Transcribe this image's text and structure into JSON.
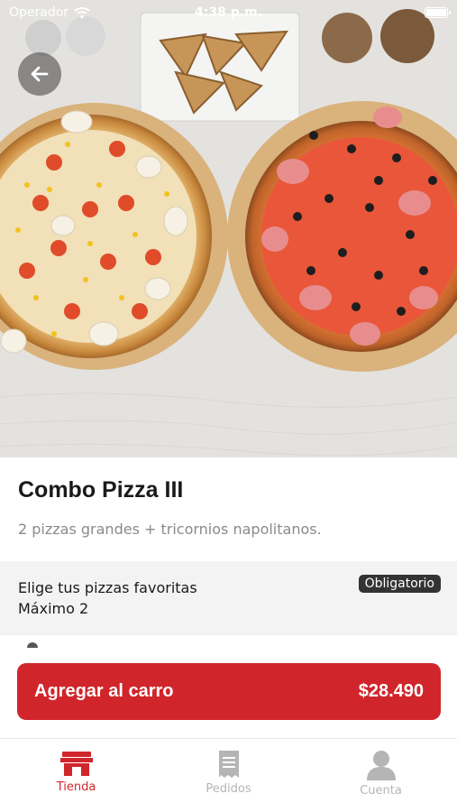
{
  "status_bar": {
    "carrier": "Operador",
    "time": "4:38 p.m."
  },
  "product": {
    "name": "Combo Pizza III",
    "description": "2 pizzas grandes + tricornios napolitanos.",
    "image_icon": "pizza-photo"
  },
  "option_group": {
    "title": "Elige tus pizzas favoritas",
    "limit": "Máximo 2",
    "badge": "Obligatorio"
  },
  "cart_button": {
    "label": "Agregar al carro",
    "price": "$28.490",
    "color": "#d0262b"
  },
  "tabs": [
    {
      "label": "Tienda",
      "icon": "store-icon",
      "active": true
    },
    {
      "label": "Pedidos",
      "icon": "receipt-icon",
      "active": false
    },
    {
      "label": "Cuenta",
      "icon": "user-icon",
      "active": false
    }
  ],
  "colors": {
    "accent": "#d0262b",
    "inactive": "#b5b5b5",
    "badge_bg": "#333333"
  }
}
